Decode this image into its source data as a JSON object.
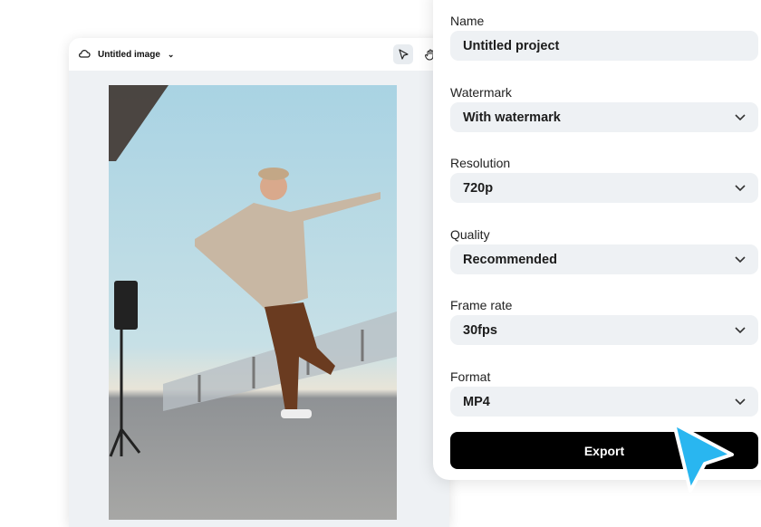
{
  "editor": {
    "title": "Untitled image"
  },
  "panel": {
    "fields": [
      {
        "label": "Name",
        "value": "Untitled project",
        "dropdown": false
      },
      {
        "label": "Watermark",
        "value": "With watermark",
        "dropdown": true
      },
      {
        "label": "Resolution",
        "value": "720p",
        "dropdown": true
      },
      {
        "label": "Quality",
        "value": "Recommended",
        "dropdown": true
      },
      {
        "label": "Frame rate",
        "value": "30fps",
        "dropdown": true
      },
      {
        "label": "Format",
        "value": "MP4",
        "dropdown": true
      }
    ],
    "export_label": "Export"
  },
  "colors": {
    "accent_cursor": "#29b6f0",
    "button": "#000000",
    "field_bg": "#eef1f4"
  }
}
